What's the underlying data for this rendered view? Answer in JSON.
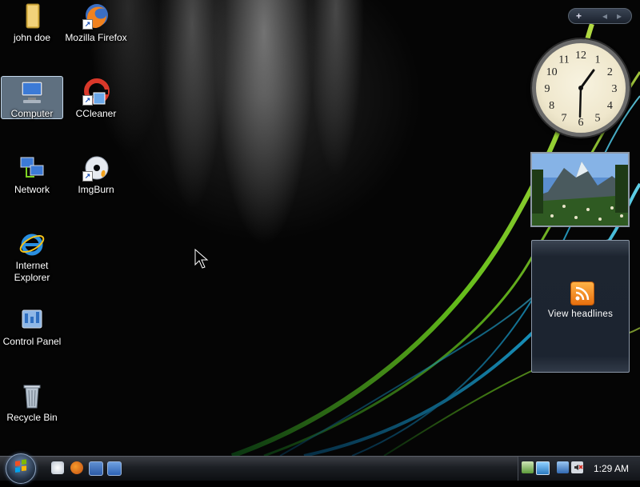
{
  "desktop": {
    "icons": [
      {
        "label": "john doe",
        "icon": "user-folder-icon"
      },
      {
        "label": "Mozilla Firefox",
        "icon": "firefox-icon"
      },
      {
        "label": "Computer",
        "icon": "computer-icon",
        "selected": true
      },
      {
        "label": "CCleaner",
        "icon": "ccleaner-icon"
      },
      {
        "label": "Network",
        "icon": "network-icon"
      },
      {
        "label": "ImgBurn",
        "icon": "imgburn-icon"
      },
      {
        "label": "Internet Explorer",
        "icon": "internet-explorer-icon"
      },
      {
        "label": "Control Panel",
        "icon": "control-panel-icon"
      },
      {
        "label": "Recycle Bin",
        "icon": "recycle-bin-icon"
      }
    ]
  },
  "sidebar": {
    "controls": {
      "add": "+",
      "prev": "◂",
      "next": "▸"
    },
    "clock": {
      "numerals": [
        "12",
        "1",
        "2",
        "3",
        "4",
        "5",
        "6",
        "7",
        "8",
        "9",
        "10",
        "11"
      ],
      "time": "1:29"
    },
    "feed": {
      "button_label": "View headlines",
      "icon": "rss-icon"
    }
  },
  "taskbar": {
    "start": "start-orb",
    "quick_launch": [
      "show-desktop-icon",
      "firefox-icon",
      "switch-windows-icon",
      "network-quick-icon"
    ],
    "tray": [
      "safely-remove-icon",
      "network-tray-icon",
      "connection-icon",
      "volume-muted-icon"
    ],
    "clock": "1:29 AM"
  },
  "colors": {
    "accent_green": "#7ed321",
    "accent_teal": "#2ab7c9",
    "feed_orange": "#f08a24"
  }
}
